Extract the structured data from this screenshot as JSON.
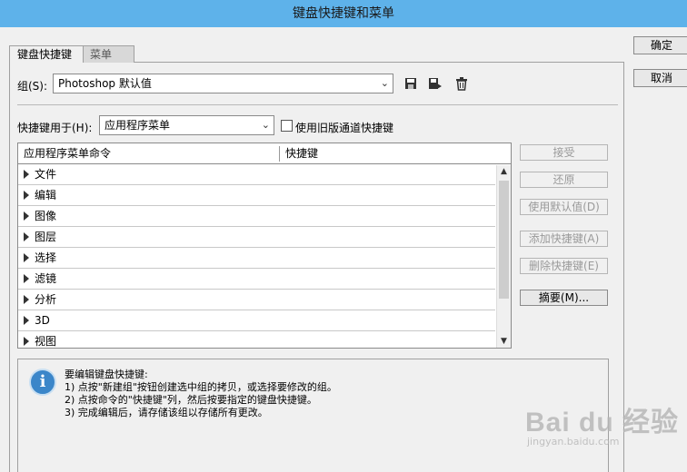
{
  "window": {
    "title": "键盘快捷键和菜单"
  },
  "tabs": [
    {
      "label": "键盘快捷键"
    },
    {
      "label": "菜单"
    }
  ],
  "group": {
    "label": "组(S):",
    "value": "Photoshop 默认值"
  },
  "shortcuts_for": {
    "label": "快捷键用于(H):",
    "value": "应用程序菜单"
  },
  "legacy_checkbox": {
    "label": "使用旧版通道快捷键",
    "checked": false
  },
  "table": {
    "headers": [
      "应用程序菜单命令",
      "快捷键"
    ],
    "rows": [
      "文件",
      "编辑",
      "图像",
      "图层",
      "选择",
      "滤镜",
      "分析",
      "3D",
      "视图"
    ]
  },
  "side_buttons": {
    "accept": "接受",
    "undo": "还原",
    "use_default": "使用默认值(D)",
    "add_shortcut": "添加快捷键(A)",
    "delete_shortcut": "删除快捷键(E)",
    "summary": "摘要(M)..."
  },
  "dialog_buttons": {
    "ok": "确定",
    "cancel": "取消"
  },
  "info": {
    "heading": "要编辑键盘快捷键:",
    "lines": [
      "1) 点按\"新建组\"按钮创建选中组的拷贝，或选择要修改的组。",
      "2) 点按命令的\"快捷键\"列，然后按要指定的键盘快捷键。",
      "3) 完成编辑后，请存储该组以存储所有更改。"
    ]
  },
  "watermark": {
    "logo": "Bai du 经验",
    "sub": "jingyan.baidu.com"
  },
  "icons": {
    "save": "save-icon",
    "save_as": "save-as-icon",
    "delete": "trash-icon",
    "info": "info-icon"
  }
}
